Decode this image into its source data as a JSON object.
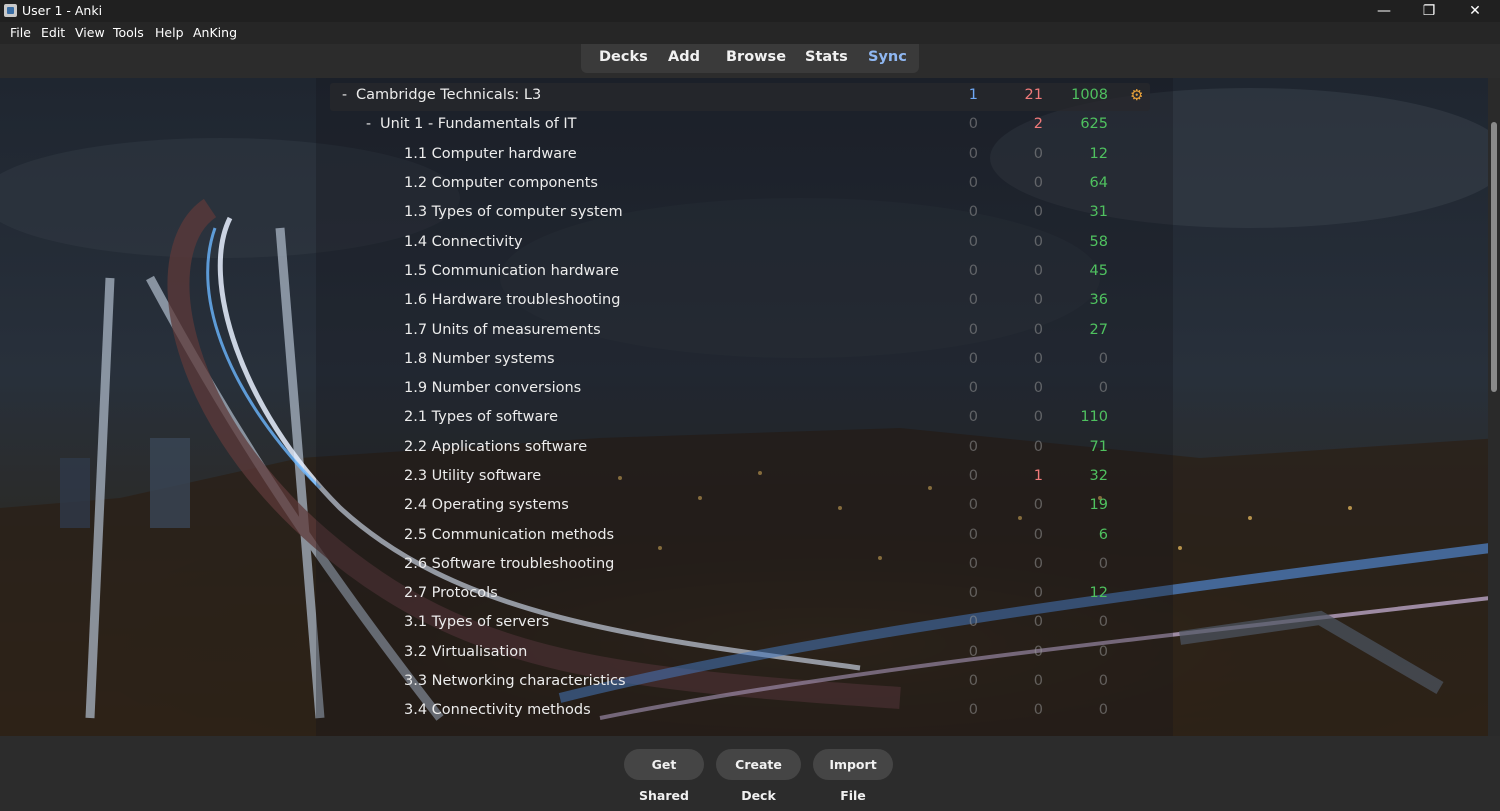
{
  "window": {
    "title": "User 1 - Anki",
    "min_glyph": "—",
    "max_glyph": "❐",
    "close_glyph": "✕"
  },
  "menu": [
    "File",
    "Edit",
    "View",
    "Tools",
    "Help",
    "AnKing"
  ],
  "toolbar": {
    "decks": "Decks",
    "add": "Add",
    "browse": "Browse",
    "stats": "Stats",
    "sync": "Sync"
  },
  "colors": {
    "new": "#6ea8f5",
    "learn": "#f07a7a",
    "review": "#4fc15f",
    "sync": "#8fb7f2"
  },
  "decks": [
    {
      "name": "Cambridge Technicals: L3",
      "collapse": "-",
      "new": "1",
      "learn": "21",
      "review": "1008",
      "options": "⚙"
    },
    {
      "name": "Unit 1 - Fundamentals of IT",
      "collapse": "-",
      "new": "0",
      "learn": "2",
      "review": "625"
    },
    {
      "name": "1.1 Computer hardware",
      "new": "0",
      "learn": "0",
      "review": "12"
    },
    {
      "name": "1.2 Computer components",
      "new": "0",
      "learn": "0",
      "review": "64"
    },
    {
      "name": "1.3 Types of computer system",
      "new": "0",
      "learn": "0",
      "review": "31"
    },
    {
      "name": "1.4 Connectivity",
      "new": "0",
      "learn": "0",
      "review": "58"
    },
    {
      "name": "1.5 Communication hardware",
      "new": "0",
      "learn": "0",
      "review": "45"
    },
    {
      "name": "1.6 Hardware troubleshooting",
      "new": "0",
      "learn": "0",
      "review": "36"
    },
    {
      "name": "1.7 Units of measurements",
      "new": "0",
      "learn": "0",
      "review": "27"
    },
    {
      "name": "1.8 Number systems",
      "new": "0",
      "learn": "0",
      "review": "0"
    },
    {
      "name": "1.9 Number conversions",
      "new": "0",
      "learn": "0",
      "review": "0"
    },
    {
      "name": "2.1 Types of software",
      "new": "0",
      "learn": "0",
      "review": "110"
    },
    {
      "name": "2.2 Applications software",
      "new": "0",
      "learn": "0",
      "review": "71"
    },
    {
      "name": "2.3 Utility software",
      "new": "0",
      "learn": "1",
      "review": "32"
    },
    {
      "name": "2.4 Operating systems",
      "new": "0",
      "learn": "0",
      "review": "19"
    },
    {
      "name": "2.5 Communication methods",
      "new": "0",
      "learn": "0",
      "review": "6"
    },
    {
      "name": "2.6 Software troubleshooting",
      "new": "0",
      "learn": "0",
      "review": "0"
    },
    {
      "name": "2.7 Protocols",
      "new": "0",
      "learn": "0",
      "review": "12"
    },
    {
      "name": "3.1 Types of servers",
      "new": "0",
      "learn": "0",
      "review": "0"
    },
    {
      "name": "3.2 Virtualisation",
      "new": "0",
      "learn": "0",
      "review": "0"
    },
    {
      "name": "3.3 Networking characteristics",
      "new": "0",
      "learn": "0",
      "review": "0"
    },
    {
      "name": "3.4 Connectivity methods",
      "new": "0",
      "learn": "0",
      "review": "0"
    }
  ],
  "bottom": {
    "get_shared": "Get Shared",
    "create_deck": "Create Deck",
    "import_file": "Import File"
  }
}
